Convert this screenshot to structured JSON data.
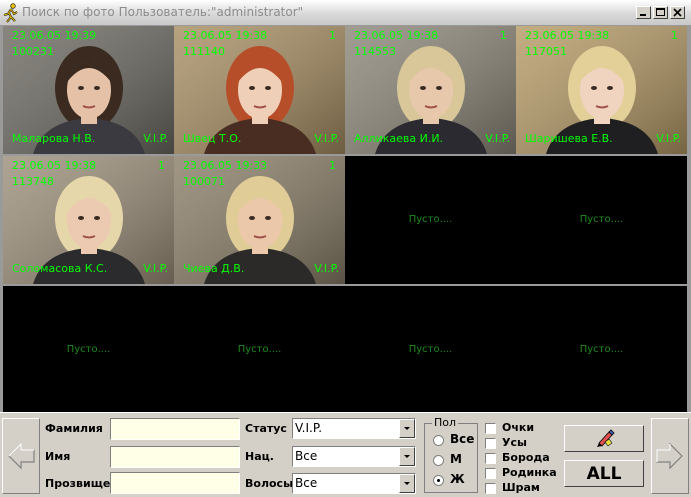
{
  "window": {
    "title": "Поиск по фото Пользователь:\"administrator\""
  },
  "grid": {
    "cells": [
      {
        "date": "23.06.05 19:39",
        "id": "100231",
        "count": "",
        "name": "Маларова Н.В.",
        "status": "V.I.P.",
        "empty": false,
        "bg": "#6d6a62",
        "skin": "#e5c2a7",
        "hair": "#3a2a20",
        "cloth": "#3a3a40"
      },
      {
        "date": "23.06.05 19:38",
        "id": "111140",
        "count": "1",
        "name": "Швец Т.О.",
        "status": "V.I.P.",
        "empty": false,
        "bg": "#a78e63",
        "skin": "#efcfb7",
        "hair": "#b64e2a",
        "cloth": "#4a2d22"
      },
      {
        "date": "23.06.05 19:38",
        "id": "114553",
        "count": "1",
        "name": "Алликаева И.И.",
        "status": "V.I.P.",
        "empty": false,
        "bg": "#8c8678",
        "skin": "#e8c8aa",
        "hair": "#d9c79a",
        "cloth": "#2a2a30"
      },
      {
        "date": "23.06.05 19:38",
        "id": "117051",
        "count": "1",
        "name": "Шаришева Е.В.",
        "status": "V.I.P.",
        "empty": false,
        "bg": "#b59a66",
        "skin": "#f0d4bf",
        "hair": "#e3cf98",
        "cloth": "#1f1f22"
      },
      {
        "date": "23.06.05 19:38",
        "id": "113748",
        "count": "1",
        "name": "Соломасова К.С.",
        "status": "V.I.P.",
        "empty": false,
        "bg": "#9c8f7a",
        "skin": "#ebcab1",
        "hair": "#e6d7aa",
        "cloth": "#2b2b2e"
      },
      {
        "date": "23.06.05 19:33",
        "id": "100071",
        "count": "1",
        "name": "Чиева Д.В.",
        "status": "V.I.P.",
        "empty": false,
        "bg": "#8a7e68",
        "skin": "#ecc8aa",
        "hair": "#e0cc96",
        "cloth": "#2c2a28"
      },
      {
        "empty": true,
        "text": "Пусто...."
      },
      {
        "empty": true,
        "text": "Пусто...."
      },
      {
        "empty": true,
        "text": "Пусто...."
      },
      {
        "empty": true,
        "text": "Пусто...."
      },
      {
        "empty": true,
        "text": "Пусто...."
      },
      {
        "empty": true,
        "text": "Пусто...."
      }
    ]
  },
  "panel": {
    "surname_label": "Фамилия",
    "name_label": "Имя",
    "nickname_label": "Прозвище",
    "surname_value": "",
    "name_value": "",
    "nickname_value": "",
    "status_label": "Статус",
    "status_value": "V.I.P.",
    "nat_label": "Нац.",
    "nat_value": "Все",
    "hair_label": "Волосы",
    "hair_value": "Все",
    "gender_title": "Пол",
    "gender_all": "Все",
    "gender_m": "М",
    "gender_f": "Ж",
    "gender_selected": "Ж",
    "features": [
      "Очки",
      "Усы",
      "Борода",
      "Родинка",
      "Шрам"
    ],
    "all_button": "ALL"
  },
  "colors": {
    "label_green": "#00ff00",
    "empty_green": "#1e8a1e",
    "input_bg": "#ffffe8"
  }
}
